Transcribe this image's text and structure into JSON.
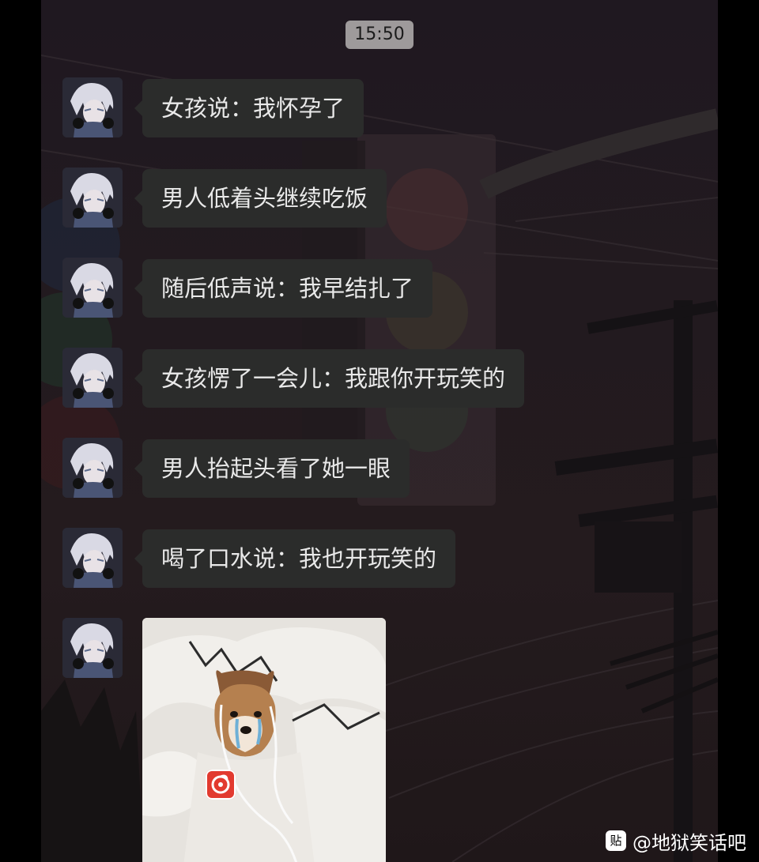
{
  "chat": {
    "time": "15:50",
    "messages": [
      {
        "text": "女孩说：我怀孕了"
      },
      {
        "text": "男人低着头继续吃饭"
      },
      {
        "text": "随后低声说：我早结扎了"
      },
      {
        "text": "女孩愣了一会儿：我跟你开玩笑的"
      },
      {
        "text": "男人抬起头看了她一眼"
      },
      {
        "text": "喝了口水说：我也开玩笑的"
      }
    ],
    "image_message": {
      "description_icon": "crying-shiba-dog-with-earphones",
      "badge_icon": "music-app-icon"
    }
  },
  "watermark": {
    "icon_glyph": "贴",
    "text": "@地狱笑话吧"
  },
  "colors": {
    "bubble": "#2b2c2b",
    "bubble_text": "#e9e9e9",
    "time_badge": "#9e9a9b",
    "background": "#221a1f"
  }
}
